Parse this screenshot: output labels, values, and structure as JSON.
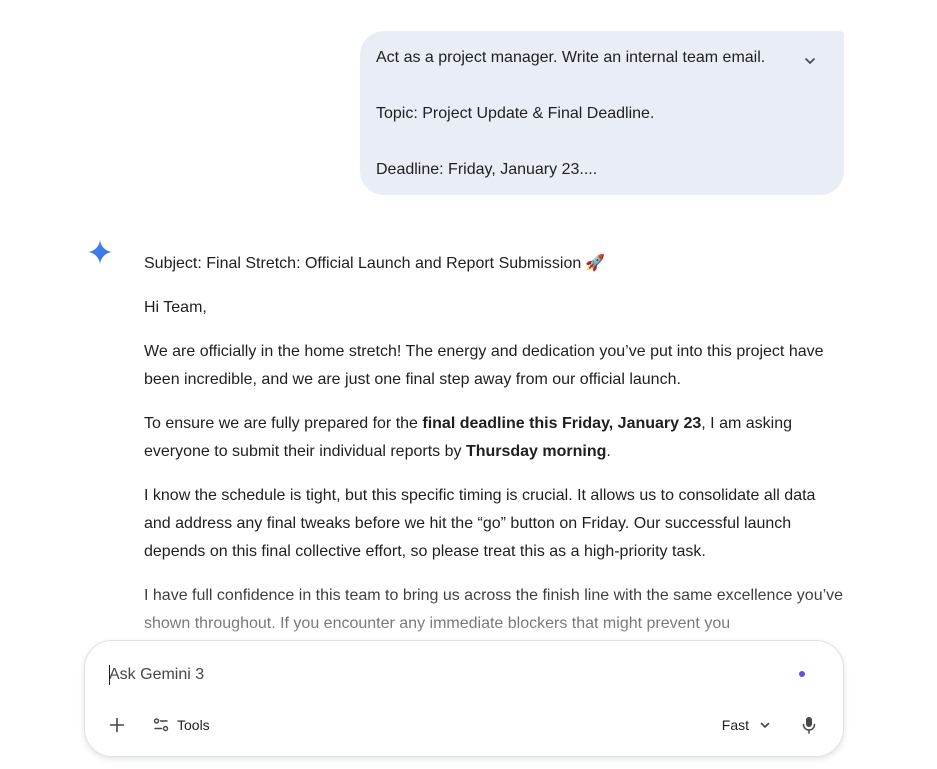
{
  "prompt": {
    "lines": [
      "Act as a project manager. Write an internal team email.",
      "Topic: Project Update & Final Deadline.",
      "Deadline: Friday, January 23...."
    ]
  },
  "response": {
    "subject": "Subject: Final Stretch: Official Launch and Report Submission",
    "greeting": "Hi Team,",
    "p1": "We are officially in the home stretch! The energy and dedication you’ve put into this project have been incredible, and we are just one final step away from our official launch.",
    "p2_before": "To ensure we are fully prepared for the ",
    "p2_bold1": "final deadline this Friday, January 23",
    "p2_mid": ", I am asking everyone to submit their individual reports by ",
    "p2_bold2": "Thursday morning",
    "p2_end": ".",
    "p3": "I know the schedule is tight, but this specific timing is crucial. It allows us to consolidate all data and address any final tweaks before we hit the “go” button on Friday. Our successful launch depends on this final collective effort, so please treat this as a high-priority task.",
    "p4": "I have full confidence in this team to bring us across the finish line with the same excellence you’ve shown throughout. If you encounter any immediate blockers that might prevent you"
  },
  "composer": {
    "placeholder": "Ask Gemini 3",
    "tools_label": "Tools",
    "mode_label": "Fast"
  },
  "colors": {
    "bubble": "#e9eef6",
    "accent_dot": "#6b4de6",
    "spark_start": "#4285f4",
    "spark_end": "#9b72cb"
  }
}
